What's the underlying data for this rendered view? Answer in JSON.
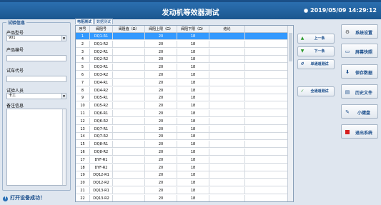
{
  "window": {
    "title_bar_text": "发动机等效器测试"
  },
  "header": {
    "title": "发动机等效器测试",
    "clock": "2019/05/09 14:29:12"
  },
  "left_panel": {
    "legend": "试验信息",
    "product_model_label": "产品型号",
    "product_model_value": "901",
    "product_number_label": "产品编号",
    "product_number_value": "",
    "test_vehicle_label": "试车代号",
    "test_vehicle_value": "",
    "tester_label": "试验人员",
    "tester_value": "卡工",
    "remarks_label": "备注信息",
    "remarks_value": ""
  },
  "status": {
    "text": "打开设备成功！"
  },
  "tabs": [
    {
      "label": "电阻测试"
    },
    {
      "label": "数据测试"
    }
  ],
  "table": {
    "columns": [
      "序号",
      "阀阻号",
      "阀阻值（Ω）",
      "阀阻上限（Ω）",
      "阀阻下限（Ω）",
      "结论"
    ],
    "rows": [
      [
        "1",
        "DQ1-R1",
        "",
        "20",
        "18",
        ""
      ],
      [
        "2",
        "DQ1-R2",
        "",
        "20",
        "18",
        ""
      ],
      [
        "3",
        "DQ2-R1",
        "",
        "20",
        "18",
        ""
      ],
      [
        "4",
        "DQ2-R2",
        "",
        "20",
        "18",
        ""
      ],
      [
        "5",
        "DQ3-R1",
        "",
        "20",
        "18",
        ""
      ],
      [
        "6",
        "DQ3-R2",
        "",
        "20",
        "18",
        ""
      ],
      [
        "7",
        "DQ4-R1",
        "",
        "20",
        "18",
        ""
      ],
      [
        "8",
        "DQ4-R2",
        "",
        "20",
        "18",
        ""
      ],
      [
        "9",
        "DQ5-R1",
        "",
        "20",
        "18",
        ""
      ],
      [
        "10",
        "DQ5-R2",
        "",
        "20",
        "18",
        ""
      ],
      [
        "11",
        "DQ6-R1",
        "",
        "20",
        "18",
        ""
      ],
      [
        "12",
        "DQ6-R2",
        "",
        "20",
        "18",
        ""
      ],
      [
        "13",
        "DQ7-R1",
        "",
        "20",
        "18",
        ""
      ],
      [
        "14",
        "DQ7-R2",
        "",
        "20",
        "18",
        ""
      ],
      [
        "15",
        "DQ8-R1",
        "",
        "20",
        "18",
        ""
      ],
      [
        "16",
        "DQ8-R2",
        "",
        "20",
        "18",
        ""
      ],
      [
        "17",
        "DYF-R1",
        "",
        "20",
        "18",
        ""
      ],
      [
        "18",
        "DYF-R2",
        "",
        "20",
        "18",
        ""
      ],
      [
        "19",
        "DQ12-R1",
        "",
        "20",
        "18",
        ""
      ],
      [
        "20",
        "DQ12-R2",
        "",
        "20",
        "18",
        ""
      ],
      [
        "21",
        "DQ13-R1",
        "",
        "20",
        "18",
        ""
      ],
      [
        "22",
        "DQ13-R2",
        "",
        "20",
        "18",
        ""
      ]
    ],
    "selected_row_index": 0
  },
  "middle_buttons": {
    "prev": "上一条",
    "next": "下一条",
    "single_test": "单通道测试",
    "all_test": "全通道测试"
  },
  "right_buttons": {
    "settings": "系统设置",
    "screenshot": "屏幕快照",
    "save": "保存数据",
    "history": "历史文件",
    "keyboard": "小键盘",
    "exit": "退出系统"
  },
  "colors": {
    "header": "#1b568f",
    "selected_row": "#3399ff",
    "accent_text": "#1c4f8c",
    "exit": "#d61f1f"
  }
}
